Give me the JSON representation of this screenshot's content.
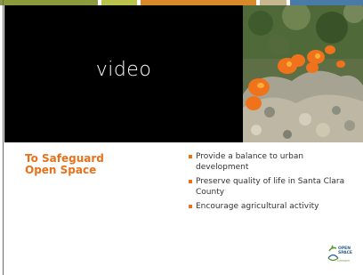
{
  "slide": {
    "video_label": "video",
    "heading_line1": "To Safeguard",
    "heading_line2": "Open Space",
    "bullets": [
      "Provide a balance to urban development",
      "Preserve quality of life in Santa Clara County",
      "Encourage agricultural activity"
    ],
    "logo": {
      "line1": "OPEN",
      "line2": "SPACE",
      "line3": "AUTHORITY"
    }
  },
  "colors": {
    "accent": "#e8711a",
    "video_bg": "#000000",
    "stripe": [
      "#8a9a3c",
      "#b9c24a",
      "#d88a2a",
      "#4a7aa8"
    ]
  },
  "icons": [
    "open-space-authority-logo"
  ]
}
